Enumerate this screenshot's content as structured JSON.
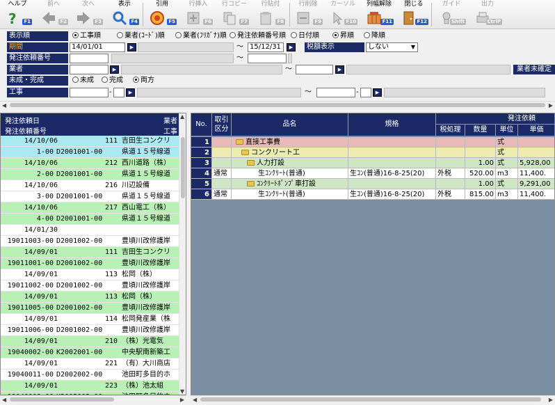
{
  "toolbar": {
    "help": {
      "label": "ヘルプ",
      "key": "F1"
    },
    "prev": {
      "label": "前へ",
      "key": "F2"
    },
    "next": {
      "label": "次へ",
      "key": "F3"
    },
    "display": {
      "label": "表示",
      "key": "F4"
    },
    "cite": {
      "label": "引用",
      "key": "F5"
    },
    "row_insert": {
      "label": "行挿入",
      "key": "F6"
    },
    "row_copy": {
      "label": "行コピー",
      "key": "F7"
    },
    "row_paste": {
      "label": "行貼付",
      "key": "F8"
    },
    "row_delete": {
      "label": "行削除",
      "key": "F9"
    },
    "cursor": {
      "label": "カーソル",
      "key": "F10"
    },
    "col_release": {
      "label": "列幅解除",
      "key": "F11"
    },
    "close": {
      "label": "閉じる",
      "key": "F12"
    },
    "guide": {
      "label": "ガイド",
      "key": "Shift"
    },
    "output": {
      "label": "出力",
      "key": "CtrlP"
    }
  },
  "form": {
    "display_order": {
      "label": "表示順",
      "options": [
        "工事順",
        "業者(ｺｰﾄﾞ)順",
        "業者(ﾌﾘｶﾞﾅ)順",
        "発注依頼番号順",
        "日付順"
      ],
      "selected": 0,
      "dir_options": [
        "昇順",
        "降順"
      ],
      "dir_selected": 0
    },
    "period": {
      "label": "期間",
      "from": "14/01/01",
      "tilde": "～",
      "to": "15/12/31"
    },
    "tax_display": {
      "label": "税額表示",
      "value": "しない"
    },
    "order_no": {
      "label": "発注依頼番号",
      "tilde": "～"
    },
    "vendor": {
      "label": "業者",
      "tilde": "～",
      "unconfirmed_label": "業者未確定"
    },
    "status": {
      "label": "未成・完成",
      "options": [
        "未成",
        "完成",
        "両方"
      ],
      "selected": 2
    },
    "project": {
      "label": "工事",
      "dash": "-",
      "tilde": "～",
      "dash2": "-"
    }
  },
  "left_table": {
    "headers": {
      "date": "発注依頼日",
      "vendor": "業者",
      "number": "発注依頼番号",
      "project": "工事"
    },
    "rows": [
      {
        "date": "14/10/06",
        "code": "111",
        "name": "吉田生コンクリ",
        "no": "1-00",
        "req": "D2001001-00",
        "proj": "県道１５号線道",
        "hl": true
      },
      {
        "date": "14/10/06",
        "code": "212",
        "name": "西川道路（株）",
        "no": "2-00",
        "req": "D2001001-00",
        "proj": "県道１５号線道",
        "hl": true
      },
      {
        "date": "14/10/06",
        "code": "216",
        "name": "川辺設備",
        "no": "3-00",
        "req": "D2001001-00",
        "proj": "県道１５号線道",
        "hl": false
      },
      {
        "date": "14/10/06",
        "code": "217",
        "name": "西山電工（株）",
        "no": "4-00",
        "req": "D2001001-00",
        "proj": "県道１５号線道",
        "hl": true
      },
      {
        "date": "14/01/30",
        "code": "",
        "name": "",
        "no": "19011003-00",
        "req": "D2001002-00",
        "proj": "豊頃川改修護岸",
        "hl": false
      },
      {
        "date": "14/09/01",
        "code": "111",
        "name": "吉田生コンクリ",
        "no": "19011001-00",
        "req": "D2001002-00",
        "proj": "豊頃川改修護岸",
        "hl": true
      },
      {
        "date": "14/09/01",
        "code": "113",
        "name": "松岡（株）",
        "no": "19011002-00",
        "req": "D2001002-00",
        "proj": "豊頃川改修護岸",
        "hl": false
      },
      {
        "date": "14/09/01",
        "code": "113",
        "name": "松岡（株）",
        "no": "19011005-00",
        "req": "D2001002-00",
        "proj": "豊頃川改修護岸",
        "hl": true
      },
      {
        "date": "14/09/01",
        "code": "114",
        "name": "松岡発産業（株",
        "no": "19011006-00",
        "req": "D2001002-00",
        "proj": "豊頃川改修護岸",
        "hl": false
      },
      {
        "date": "14/09/01",
        "code": "210",
        "name": "（株）光電気",
        "no": "19040002-00",
        "req": "K2002001-00",
        "proj": "中央駅南新築工",
        "hl": true
      },
      {
        "date": "14/09/01",
        "code": "221",
        "name": "（有）大川商店",
        "no": "19040011-00",
        "req": "D2002002-00",
        "proj": "池田町多目的ホ",
        "hl": false
      },
      {
        "date": "14/09/01",
        "code": "223",
        "name": "（株）池太組",
        "no": "19040008-00",
        "req": "K2002002-00",
        "proj": "池田町多目的ホ",
        "hl": true
      },
      {
        "date": "14/09/01",
        "code": "224",
        "name": "（有）アイコー",
        "no": "",
        "req": "",
        "proj": "",
        "hl": false
      }
    ]
  },
  "right_table": {
    "headers": {
      "no": "No.",
      "torihiki": "取引区分",
      "item": "品名",
      "spec": "規格",
      "group": "発注依頼",
      "tax": "税処理",
      "qty": "数量",
      "unit": "単位",
      "price": "単価"
    },
    "rows": [
      {
        "no": "1",
        "kubun": "",
        "name": "直接工事費",
        "indent": 0,
        "spec": "",
        "tax": "",
        "qty": "",
        "unit": "式",
        "price": "",
        "bg": "#e9b9b9"
      },
      {
        "no": "2",
        "kubun": "",
        "name": "コンクリート工",
        "indent": 1,
        "spec": "",
        "tax": "",
        "qty": "",
        "unit": "式",
        "price": "",
        "bg": "#ecebb0"
      },
      {
        "no": "3",
        "kubun": "",
        "name": "人力打設",
        "indent": 2,
        "spec": "",
        "tax": "",
        "qty": "1.00",
        "unit": "式",
        "price": "5,928,00",
        "bg": "#cfe6c5"
      },
      {
        "no": "4",
        "kubun": "通常",
        "name": "生ｺﾝｸﾘｰﾄ(普通)",
        "indent": 4,
        "spec": "生ｺﾝ(普通)16-8-25(20)",
        "tax": "外税",
        "qty": "520.00",
        "unit": "m3",
        "price": "11,400.",
        "bg": "#ffffff"
      },
      {
        "no": "5",
        "kubun": "",
        "name": "ｺﾝｸﾘｰﾄﾎﾟﾝﾌﾟ車打設",
        "indent": 2,
        "spec": "",
        "tax": "",
        "qty": "1.00",
        "unit": "式",
        "price": "9,291,00",
        "bg": "#cfe6c5"
      },
      {
        "no": "6",
        "kubun": "通常",
        "name": "生ｺﾝｸﾘｰﾄ(普通)",
        "indent": 4,
        "spec": "生ｺﾝ(普通)16-8-25(20)",
        "tax": "外税",
        "qty": "815.00",
        "unit": "m3",
        "price": "11,400.",
        "bg": "#ffffff"
      }
    ]
  }
}
